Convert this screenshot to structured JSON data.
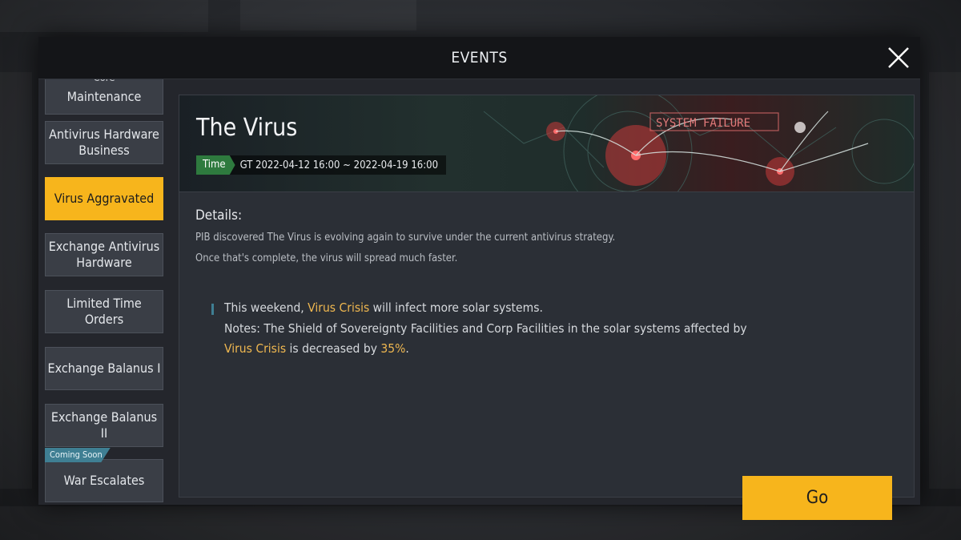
{
  "modal": {
    "title": "EVENTS"
  },
  "sidebar": {
    "items": [
      {
        "label": "Maintenance",
        "top_label": "Core"
      },
      {
        "label": "Antivirus Hardware Business"
      },
      {
        "label": "Virus Aggravated",
        "active": true
      },
      {
        "label": "Exchange Antivirus Hardware"
      },
      {
        "label": "Limited Time Orders"
      },
      {
        "label": "Exchange Balanus I"
      },
      {
        "label": "Exchange Balanus II"
      },
      {
        "label": "War Escalates",
        "badge": "Coming Soon"
      }
    ]
  },
  "event": {
    "title": "The Virus",
    "time_tag": "Time",
    "time_value": "GT 2022-04-12 16:00 ~ 2022-04-19 16:00",
    "banner_text": "SYSTEM FAILURE",
    "details_title": "Details:",
    "details_line1": "PIB discovered The Virus is evolving again to survive under the current antivirus strategy.",
    "details_line2": "Once that's complete, the virus will spread much faster.",
    "note": {
      "l1_pre": "This weekend, ",
      "l1_hl": "Virus Crisis",
      "l1_post": " will infect more solar systems.",
      "l2": "Notes: The Shield of Sovereignty Facilities and Corp Facilities in the solar systems affected by",
      "l3_hl": "Virus Crisis",
      "l3_mid": " is decreased by ",
      "l3_pct": "35%",
      "l3_end": "."
    },
    "go_label": "Go"
  },
  "colors": {
    "accent": "#f7b51c",
    "highlight": "#f0b850",
    "time_tag": "#2e7a3e",
    "badge": "#3f7f93",
    "panel": "#2b2f36"
  }
}
